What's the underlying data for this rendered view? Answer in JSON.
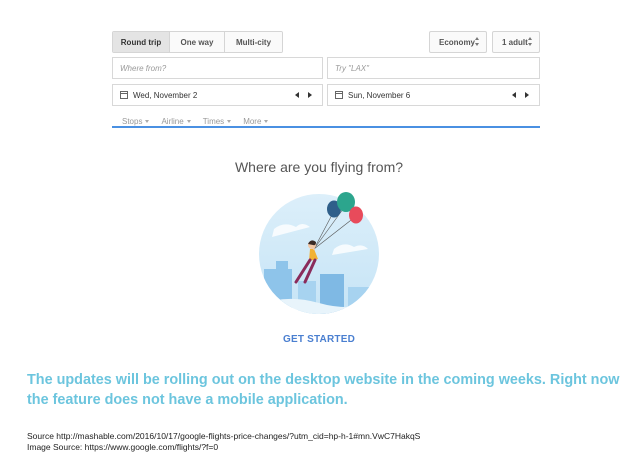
{
  "search": {
    "trip_types": [
      {
        "label": "Round trip",
        "active": true
      },
      {
        "label": "One way",
        "active": false
      },
      {
        "label": "Multi-city",
        "active": false
      }
    ],
    "cabin_class": "Economy",
    "passengers": "1 adult",
    "from_placeholder": "Where from?",
    "to_placeholder": "Try \"LAX\"",
    "depart_date": "Wed, November 2",
    "return_date": "Sun, November 6",
    "filters": [
      "Stops",
      "Airline",
      "Times",
      "More"
    ],
    "accent_color": "#4a90e2"
  },
  "main": {
    "question": "Where are you flying from?",
    "cta": "GET STARTED",
    "cta_color": "#4a7fd0"
  },
  "caption": {
    "text": "The updates will be rolling out on the desktop website in the coming weeks. Right now the feature does not have a mobile application.",
    "color": "#6cc5de"
  },
  "footer": {
    "source": "Source http://mashable.com/2016/10/17/google-flights-price-changes/?utm_cid=hp-h-1#mn.VwC7HakqS",
    "image_source": "Image Source: https://www.google.com/flights/?f=0"
  }
}
